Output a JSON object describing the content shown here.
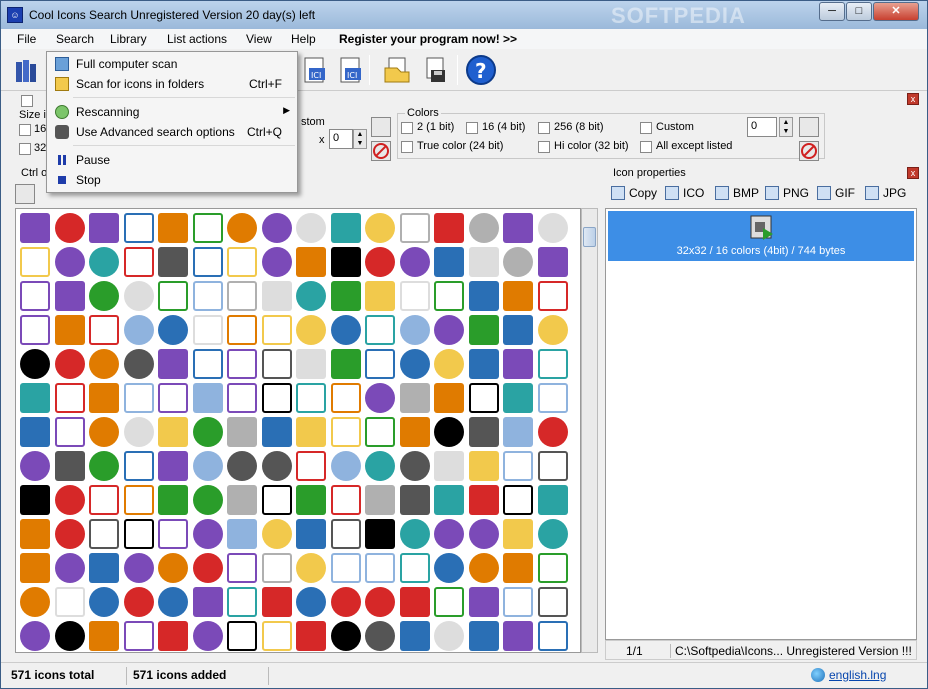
{
  "window": {
    "icon": "app-icon",
    "title": "Cool Icons Search  Unregistered Version 20 day(s) left",
    "watermark": "SOFTPEDIA",
    "buttons": {
      "minimize": "─",
      "maximize": "□",
      "close": "✕"
    }
  },
  "menu": {
    "items": [
      "File",
      "Search",
      "Library",
      "List actions",
      "View",
      "Help"
    ],
    "register": "Register your program now! >>"
  },
  "search_menu": {
    "items": [
      {
        "label": "Full computer scan",
        "shortcut": "",
        "icon": "computer-scan-icon"
      },
      {
        "label": "Scan for icons in folders",
        "shortcut": "Ctrl+F",
        "icon": "folder-scan-icon"
      },
      {
        "label": "Rescanning",
        "shortcut": "",
        "icon": "rescan-icon",
        "submenu": true
      },
      {
        "label": "Use Advanced search options",
        "shortcut": "Ctrl+Q",
        "icon": "detective-icon"
      },
      {
        "label": "Pause",
        "shortcut": "",
        "icon": "pause-icon"
      },
      {
        "label": "Stop",
        "shortcut": "",
        "icon": "stop-icon"
      }
    ]
  },
  "search_options": {
    "size_label": "Size i",
    "size_values": [
      "16",
      "32"
    ],
    "custom_size_label": "stom",
    "custom_size_x": "x",
    "custom_size_value": "0",
    "colors_label": "Colors",
    "colors": [
      "2 (1 bit)",
      "16 (4 bit)",
      "256 (8 bit)",
      "Custom",
      "True color (24 bit)",
      "Hi color (32 bit)",
      "All except listed"
    ],
    "custom_color_value": "0",
    "close": "x"
  },
  "list_panel": {
    "label": "Ctrl o",
    "close": "x"
  },
  "icon_properties": {
    "title": "Icon properties",
    "close": "x",
    "formats": [
      "Copy",
      "ICO",
      "BMP",
      "PNG",
      "GIF",
      "JPG"
    ],
    "selected_info": "32x32 / 16 colors (4bit) / 744 bytes",
    "page": "1/1",
    "path": "C:\\Softpedia\\Icons... Unregistered Version !!!"
  },
  "status": {
    "total": "571 icons total",
    "added": "571 icons added",
    "language_link": "english.lng"
  },
  "colors": {
    "accent_blue": "#3d8ee6",
    "title_bar": "#9bb9da"
  }
}
